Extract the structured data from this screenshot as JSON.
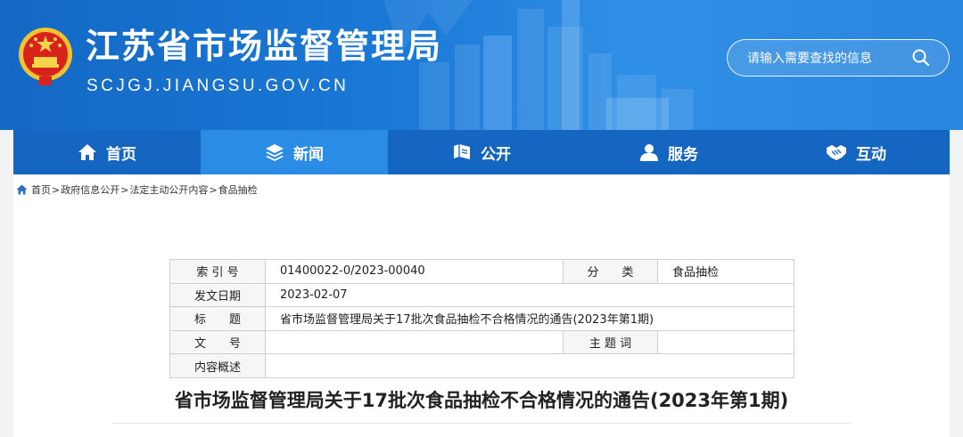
{
  "header": {
    "site_title": "江苏省市场监督管理局",
    "site_domain": "SCJGJ.JIANGSU.GOV.CN",
    "search_placeholder": "请输入需要查找的信息",
    "search_icon": "search-icon",
    "emblem_icon": "national-emblem-icon"
  },
  "nav": {
    "items": [
      {
        "label": "首页",
        "icon": "home-icon",
        "active": false
      },
      {
        "label": "新闻",
        "icon": "layers-icon",
        "active": true
      },
      {
        "label": "公开",
        "icon": "book-icon",
        "active": false
      },
      {
        "label": "服务",
        "icon": "user-icon",
        "active": false
      },
      {
        "label": "互动",
        "icon": "handshake-icon",
        "active": false
      }
    ]
  },
  "breadcrumb": {
    "icon": "home-icon",
    "items": [
      "首页",
      "政府信息公开",
      "法定主动公开内容",
      "食品抽检"
    ],
    "separator": ">"
  },
  "meta_table": {
    "index_label": "索 引 号",
    "index_value": "01400022-0/2023-00040",
    "category_label": "分　　类",
    "category_value": "食品抽检",
    "date_label": "发文日期",
    "date_value": "2023-02-07",
    "title_label": "标　　题",
    "title_value": "省市场监督管理局关于17批次食品抽检不合格情况的通告(2023年第1期)",
    "docnum_label": "文　　号",
    "docnum_value": "",
    "topic_label": "主 题 词",
    "topic_value": "",
    "summary_label": "内容概述",
    "summary_value": ""
  },
  "document": {
    "title": "省市场监督管理局关于17批次食品抽检不合格情况的通告(2023年第1期)"
  },
  "colors": {
    "header_blue": "#1a78d6",
    "nav_blue": "#1466c0",
    "nav_active": "#2b8ce6",
    "page_bg": "#f2f3f5"
  }
}
